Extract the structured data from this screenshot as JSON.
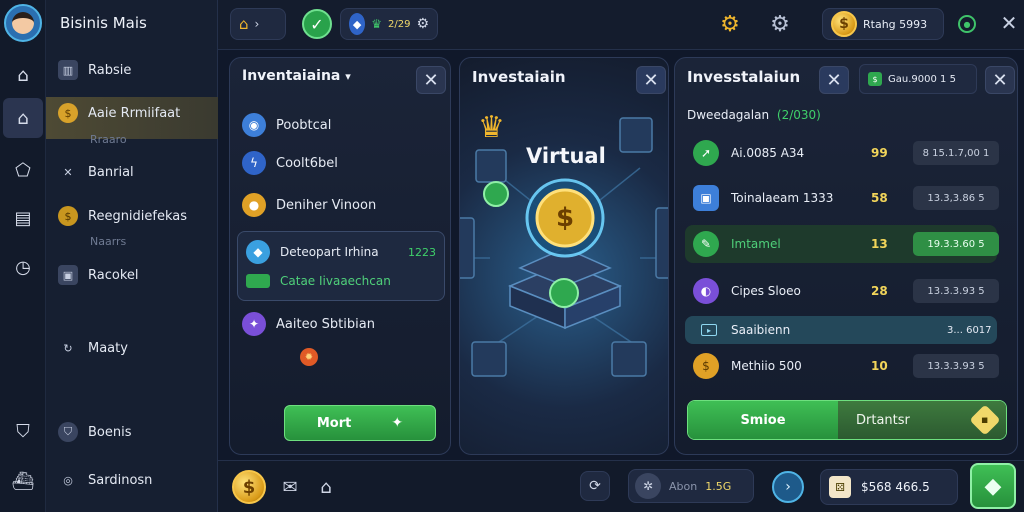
{
  "app": {
    "title": "Bisinis Mais"
  },
  "rail": {
    "icons": [
      "home-outline-icon",
      "home-icon",
      "tag-icon",
      "card-icon",
      "clock-icon",
      "shield-icon",
      "ship-icon"
    ]
  },
  "sidebar": {
    "items": [
      {
        "label": "Rabsie",
        "icon": "chart-icon"
      },
      {
        "label": "Aaie Rrmiifaat",
        "sub": "Rraaro",
        "icon": "coin-icon"
      },
      {
        "label": "Banrial",
        "icon": "tools-icon"
      },
      {
        "label": "Reegnidiefekas",
        "sub": "Naarrs",
        "icon": "coin-icon"
      },
      {
        "label": "Racokel",
        "icon": "box-icon"
      },
      {
        "label": "Maaty",
        "icon": "sync-icon"
      },
      {
        "label": "Boenis",
        "icon": "shield-icon"
      },
      {
        "label": "Sardinosn",
        "icon": "globe-icon"
      }
    ]
  },
  "topbar": {
    "chip_badge": "2/29",
    "balance": "Rtahg 5993",
    "accent": "#f0b62d"
  },
  "panel_left": {
    "title": "Inventaiaina",
    "items": [
      {
        "label": "Poobtcal",
        "color": "#3d7fd9"
      },
      {
        "label": "Coolt6bel",
        "color": "#2f64c8"
      },
      {
        "label": "Deniher Vinoon",
        "color": "#e0a126"
      },
      {
        "label": "Deteopart Irhina",
        "value": "1223",
        "sub": "Catae Iivaaechcan",
        "color": "#3aa0e0"
      },
      {
        "label": "Aaiteo Sbtibian",
        "color": "#7a4fd8"
      }
    ],
    "more_label": "Mort"
  },
  "panel_mid": {
    "title": "Investaiain",
    "hero_label": "Virtual"
  },
  "panel_right": {
    "title": "Invesstalaiun",
    "extra_chip": "Gau.9000  1 5",
    "header": "Dweedagalan",
    "header_value": "(2/030)",
    "rows": [
      {
        "name": "Ai.0085  A34",
        "qty": "99",
        "value": "8 15.1.7,00 1",
        "color": "#2fa84f"
      },
      {
        "name": "Toinalaeam  1333",
        "qty": "58",
        "value": "13.3,3.86 5",
        "color": "#3d7fd9"
      },
      {
        "name": "Imtamel",
        "qty": "13",
        "value": "19.3.3.60 5",
        "color": "#2fa84f",
        "highlight": true
      },
      {
        "name": "Cipes Sloeo",
        "qty": "28",
        "value": "13.3.3.93 5",
        "color": "#7a4fd8"
      },
      {
        "name": "Saaibienn",
        "qty": "",
        "value": "3... 6017",
        "color": "#4aa6c9",
        "plain": true
      },
      {
        "name": "Methiio  500",
        "qty": "10",
        "value": "13.3.3.93 5",
        "color": "#e0a126"
      }
    ],
    "btn_left": "Smioe",
    "btn_right": "Drtantsr"
  },
  "bottombar": {
    "status_label": "Abon",
    "status_value": "1.5G",
    "credits": "$568 466.5"
  }
}
